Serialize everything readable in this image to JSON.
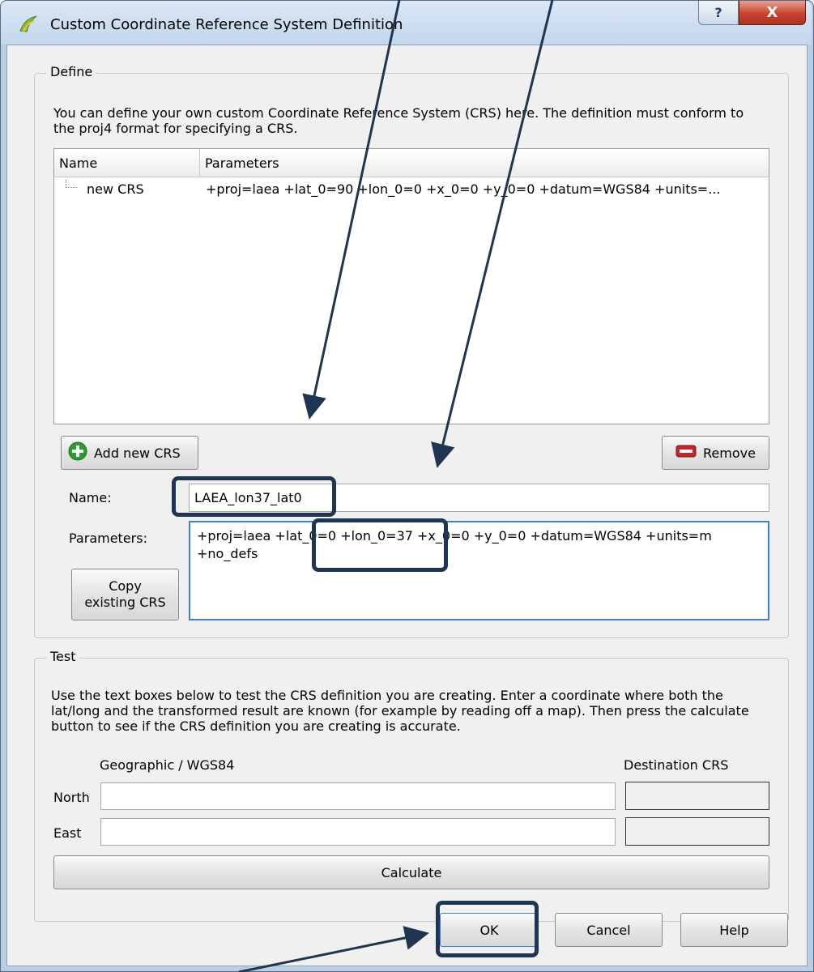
{
  "window": {
    "title": "Custom Coordinate Reference System Definition",
    "help_glyph": "?",
    "close_glyph": "X"
  },
  "define": {
    "group_title": "Define",
    "description": "You can define your own custom Coordinate Reference System (CRS) here. The definition must conform to the proj4 format for specifying a CRS.",
    "table": {
      "columns": [
        "Name",
        "Parameters"
      ],
      "rows": [
        {
          "name": "new CRS",
          "parameters": "+proj=laea +lat_0=90 +lon_0=0 +x_0=0 +y_0=0 +datum=WGS84 +units=..."
        }
      ]
    },
    "add_button": "Add new CRS",
    "remove_button": "Remove",
    "name_label": "Name:",
    "name_value": "LAEA_lon37_lat0",
    "parameters_label": "Parameters:",
    "parameters_line1": "+proj=laea +lat_0=0 +lon_0=37 +x_0=0 +y_0=0 +datum=WGS84 +units=m",
    "parameters_line2": "+no_defs",
    "copy_button_line1": "Copy",
    "copy_button_line2": "existing CRS"
  },
  "test": {
    "group_title": "Test",
    "description": "Use the text boxes below to test the CRS definition you are creating. Enter a coordinate where both the lat/long and the transformed result are known (for example by reading off a map). Then press the calculate button to see if the CRS definition you are creating is accurate.",
    "geographic_header": "Geographic / WGS84",
    "destination_header": "Destination CRS",
    "north_label": "North",
    "east_label": "East",
    "north_value": "",
    "east_value": "",
    "calculate_button": "Calculate"
  },
  "footer": {
    "ok_button": "OK",
    "cancel_button": "Cancel",
    "help_button": "Help"
  },
  "colors": {
    "annotation": "#1f3552",
    "focus_border": "#3c7fd3",
    "add_icon": "#2e9b2e",
    "remove_icon": "#c0272d"
  }
}
